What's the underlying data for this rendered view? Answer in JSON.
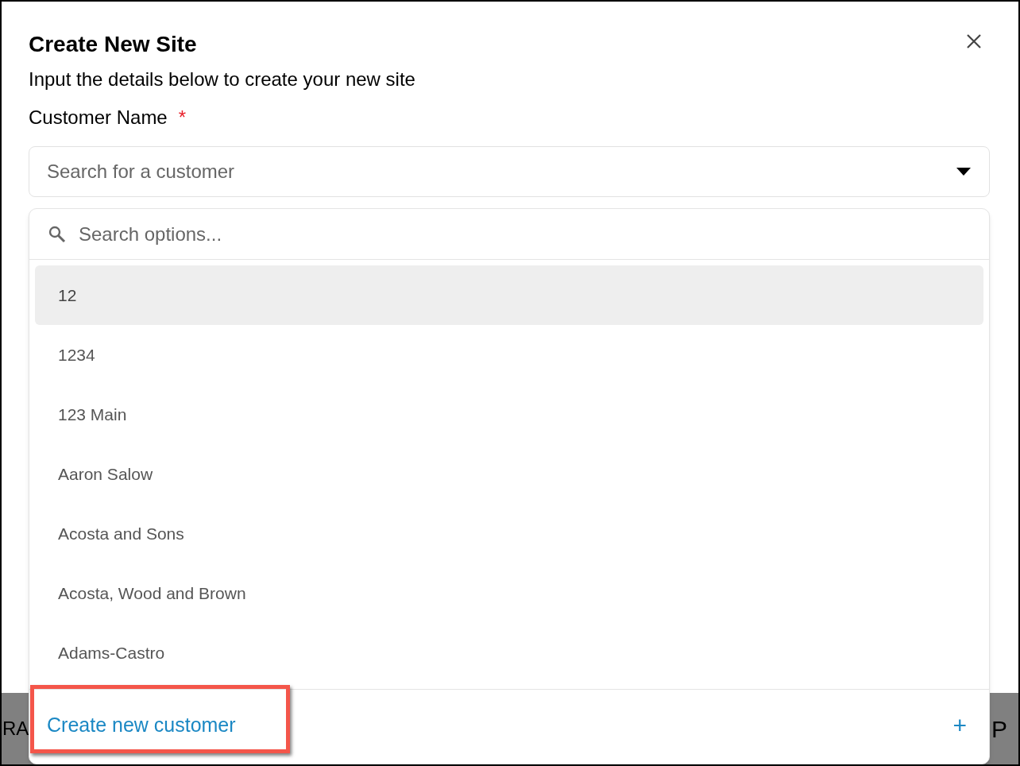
{
  "dialog": {
    "title": "Create New Site",
    "subtitle": "Input the details below to create your new site"
  },
  "field": {
    "label": "Customer Name",
    "required_mark": "*",
    "placeholder": "Search for a customer"
  },
  "dropdown": {
    "search_placeholder": "Search options...",
    "options": [
      {
        "label": "12",
        "selected": true
      },
      {
        "label": "1234",
        "selected": false
      },
      {
        "label": "123 Main",
        "selected": false
      },
      {
        "label": "Aaron Salow",
        "selected": false
      },
      {
        "label": "Acosta and Sons",
        "selected": false
      },
      {
        "label": "Acosta, Wood and Brown",
        "selected": false
      },
      {
        "label": "Adams-Castro",
        "selected": false
      }
    ],
    "footer_action": {
      "label": "Create new customer",
      "icon_text": "+"
    }
  },
  "background": {
    "left_text": "RA",
    "right_text": "P"
  }
}
